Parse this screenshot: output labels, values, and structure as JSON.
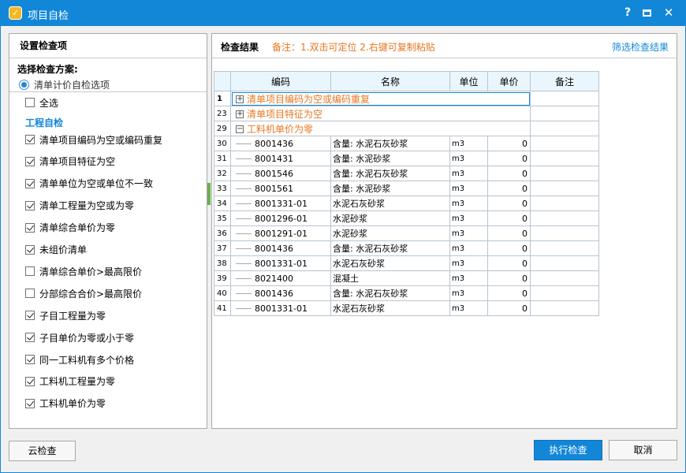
{
  "window": {
    "title": "项目自检",
    "help": "?",
    "close": "✕"
  },
  "left_panel": {
    "header": "设置检查项",
    "scheme_title": "选择检查方案:",
    "scheme_option": "清单计价自检选项",
    "select_all": "全选",
    "section_heading": "工程自检",
    "options": [
      {
        "label": "清单项目编码为空或编码重复",
        "checked": true
      },
      {
        "label": "清单项目特征为空",
        "checked": true
      },
      {
        "label": "清单单位为空或单位不一致",
        "checked": true
      },
      {
        "label": "清单工程量为空或为零",
        "checked": true
      },
      {
        "label": "清单综合单价为零",
        "checked": true
      },
      {
        "label": "未组价清单",
        "checked": true
      },
      {
        "label": "清单综合单价>最高限价",
        "checked": false
      },
      {
        "label": "分部综合合价>最高限价",
        "checked": false
      },
      {
        "label": "子目工程量为零",
        "checked": true
      },
      {
        "label": "子目单价为零或小于零",
        "checked": true
      },
      {
        "label": "同一工料机有多个价格",
        "checked": true
      },
      {
        "label": "工料机工程量为零",
        "checked": true
      },
      {
        "label": "工料机单价为零",
        "checked": true
      }
    ]
  },
  "right_panel": {
    "title": "检查结果",
    "note": "备注：1.双击可定位 2.右键可复制粘贴",
    "filter_link": "筛选检查结果",
    "columns": [
      "编码",
      "名称",
      "单位",
      "单价",
      "备注"
    ],
    "groups": [
      {
        "row": "1",
        "label": "清单项目编码为空或编码重复",
        "expander": "+"
      },
      {
        "row": "23",
        "label": "清单项目特征为空",
        "expander": "+"
      },
      {
        "row": "29",
        "label": "工料机单价为零",
        "expander": "−"
      }
    ],
    "rows": [
      {
        "row": "30",
        "code": "8001436",
        "name": "含量: 水泥石灰砂浆",
        "unit": "m3",
        "price": "0",
        "remark": ""
      },
      {
        "row": "31",
        "code": "8001431",
        "name": "含量: 水泥砂浆",
        "unit": "m3",
        "price": "0",
        "remark": ""
      },
      {
        "row": "32",
        "code": "8001546",
        "name": "含量: 水泥石灰砂浆",
        "unit": "m3",
        "price": "0",
        "remark": ""
      },
      {
        "row": "33",
        "code": "8001561",
        "name": "含量: 水泥砂浆",
        "unit": "m3",
        "price": "0",
        "remark": ""
      },
      {
        "row": "34",
        "code": "8001331-01",
        "name": "水泥石灰砂浆",
        "unit": "m3",
        "price": "0",
        "remark": ""
      },
      {
        "row": "35",
        "code": "8001296-01",
        "name": "水泥砂浆",
        "unit": "m3",
        "price": "0",
        "remark": ""
      },
      {
        "row": "36",
        "code": "8001291-01",
        "name": "水泥砂浆",
        "unit": "m3",
        "price": "0",
        "remark": ""
      },
      {
        "row": "37",
        "code": "8001436",
        "name": "含量: 水泥石灰砂浆",
        "unit": "m3",
        "price": "0",
        "remark": ""
      },
      {
        "row": "38",
        "code": "8001331-01",
        "name": "水泥石灰砂浆",
        "unit": "m3",
        "price": "0",
        "remark": ""
      },
      {
        "row": "39",
        "code": "8021400",
        "name": "混凝土",
        "unit": "m3",
        "price": "0",
        "remark": ""
      },
      {
        "row": "40",
        "code": "8001436",
        "name": "含量: 水泥石灰砂浆",
        "unit": "m3",
        "price": "0",
        "remark": ""
      },
      {
        "row": "41",
        "code": "8001331-01",
        "name": "水泥石灰砂浆",
        "unit": "m3",
        "price": "0",
        "remark": ""
      }
    ]
  },
  "buttons": {
    "cloud_check": "云检查",
    "run_check": "执行检查",
    "cancel": "取消"
  },
  "colors": {
    "accent": "#1287d8",
    "note": "#e87722",
    "header_bg": "#eaf6fd"
  }
}
